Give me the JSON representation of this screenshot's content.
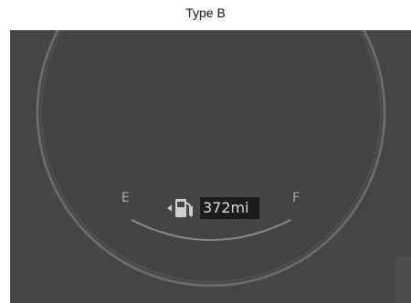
{
  "caption": "Type B",
  "gauge": {
    "empty_label": "E",
    "full_label": "F",
    "range_text": "372mi",
    "fuel_icon": "fuel-pump-icon",
    "door_side_indicator": "left-arrow-icon"
  },
  "colors": {
    "panel": "#454545",
    "ring": "#6a6a6a",
    "label": "#a9a9a9",
    "range_box": "#1c1c1c",
    "range_text": "#d8d8d8"
  }
}
